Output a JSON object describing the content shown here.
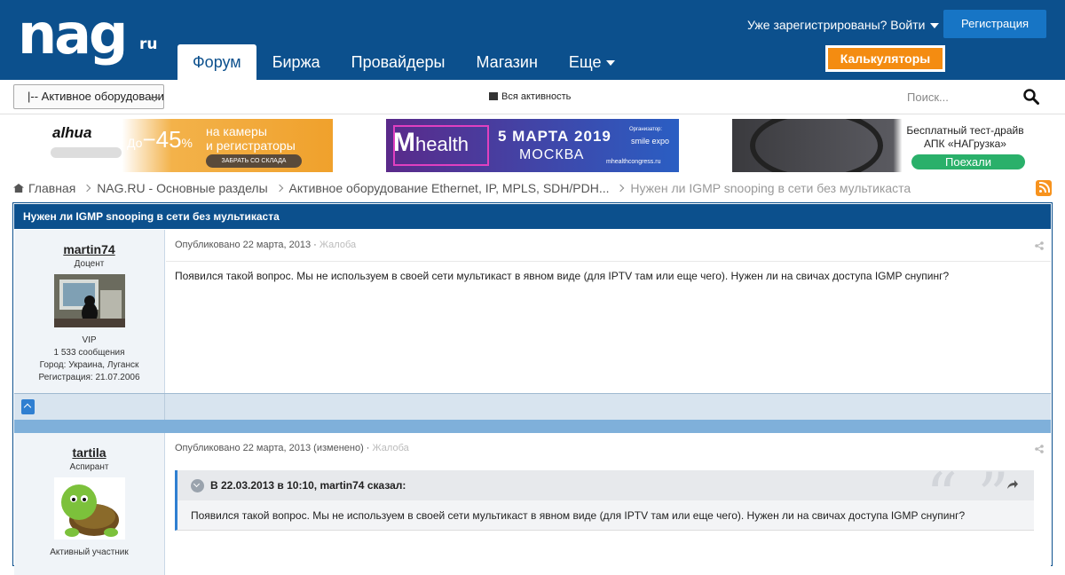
{
  "header": {
    "logo_main": "nag",
    "logo_suffix": "ru",
    "tabs": [
      {
        "label": "Форум",
        "active": true
      },
      {
        "label": "Биржа"
      },
      {
        "label": "Провайдеры"
      },
      {
        "label": "Магазин"
      },
      {
        "label": "Еще"
      }
    ],
    "login_label": "Уже зарегистрированы? Войти",
    "register_label": "Регистрация",
    "calculators_label": "Калькуляторы",
    "accent": "#0c508d",
    "calc_color": "#f48c11"
  },
  "subbar": {
    "select_value": "|-- Активное оборудование",
    "activity_label": "Вся активность",
    "search_placeholder": "Поиск..."
  },
  "ads": [
    {
      "brand": "alhua",
      "discount": "До",
      "discount_num": "45",
      "pct": "%",
      "text_line1": "на камеры",
      "text_line2": "и регистраторы",
      "button": "ЗАБРАТЬ СО СКЛАДА"
    },
    {
      "logo_m": "M",
      "logo_text": "health",
      "date": "5 МАРТА 2019",
      "city": "МОСКВА",
      "organizer": "Организатор:",
      "partner": "smile expo",
      "site": "mhealthcongress.ru"
    },
    {
      "text": "Бесплатный тест-драйв АПК «НАГрузка»",
      "button": "Поехали"
    }
  ],
  "breadcrumbs": [
    {
      "label": "Главная"
    },
    {
      "label": "NAG.RU - Основные разделы"
    },
    {
      "label": "Активное оборудование Ethernet, IP, MPLS, SDH/PDH..."
    },
    {
      "label": "Нужен ли IGMP snooping в сети без мультикаста",
      "current": true
    }
  ],
  "topic": {
    "title": "Нужен ли IGMP snooping в сети без мультикаста",
    "posts": [
      {
        "author": "martin74",
        "rank": "Доцент",
        "group": "VIP",
        "messages": "1 533 сообщения",
        "city": "Город: Украина, Луганск",
        "registered": "Регистрация: 21.07.2006",
        "published": "Опубликовано 22 марта, 2013",
        "report": "Жалоба",
        "text": "Появился такой вопрос. Мы не используем в своей сети мультикаст в явном виде (для IPTV там или еще чего). Нужен ли на свичах доступа IGMP снупинг?"
      },
      {
        "author": "tartila",
        "rank": "Аспирант",
        "group": "Активный участник",
        "published": "Опубликовано 22 марта, 2013 (изменено)",
        "report": "Жалоба",
        "quote_head": "В 22.03.2013 в 10:10, martin74 сказал:",
        "quote_text": "Появился такой вопрос. Мы не используем в своей сети мультикаст в явном виде (для IPTV там или еще чего). Нужен ли на свичах доступа IGMP снупинг?"
      }
    ]
  }
}
